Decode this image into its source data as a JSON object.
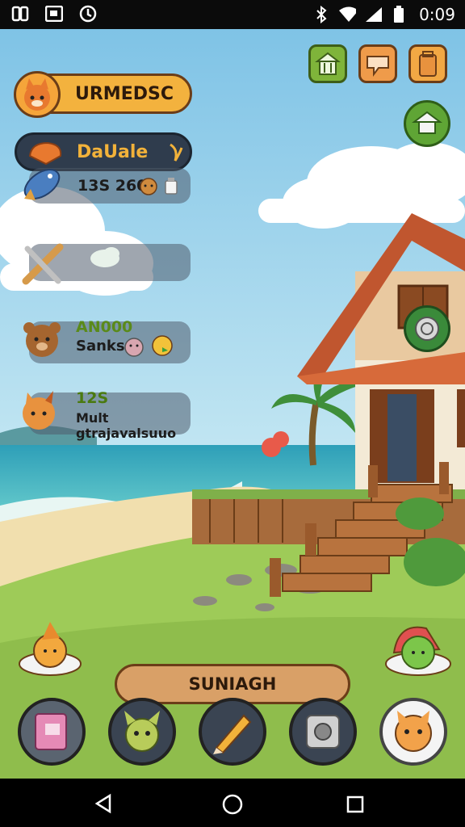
{
  "status_bar": {
    "left_icons": [
      "sim-icon",
      "screenshot-icon",
      "sync-icon"
    ],
    "right_icons": [
      "bluetooth-icon",
      "wifi-icon",
      "signal-icon",
      "battery-icon"
    ],
    "time": "0:09"
  },
  "profile": {
    "name": "URMEDSC",
    "avatar": "fox-avatar-icon"
  },
  "title_pill": {
    "label": "DaUale",
    "left_icon": "bread-icon",
    "right_icon": "sparkle-icon"
  },
  "stats": [
    {
      "icon": "fish-icon",
      "line1": "13S 260",
      "line2": ""
    },
    {
      "icon": "crossed-tools-icon",
      "line1": "",
      "line2": ""
    },
    {
      "icon": "bear-icon",
      "line1": "AN000",
      "line2": "Sanks"
    },
    {
      "icon": "fox-face-icon",
      "line1": "12S",
      "line2": "Mult gtrajavalsuuo"
    }
  ],
  "top_buttons": [
    "shop-icon",
    "chat-icon",
    "bag-icon"
  ],
  "side_buttons": [
    "house-icon",
    "compass-icon"
  ],
  "main_button": {
    "label": "SUNIAGH"
  },
  "dock": [
    "notebook-icon",
    "cat-friend-icon",
    "pencil-icon",
    "safe-icon",
    "cat-face-icon"
  ],
  "colors": {
    "sky": "#8ecbe8",
    "sea": "#3fb6c2",
    "grass": "#9ecb58",
    "accent": "#f3b23e",
    "panel": "#2f3c4d"
  }
}
